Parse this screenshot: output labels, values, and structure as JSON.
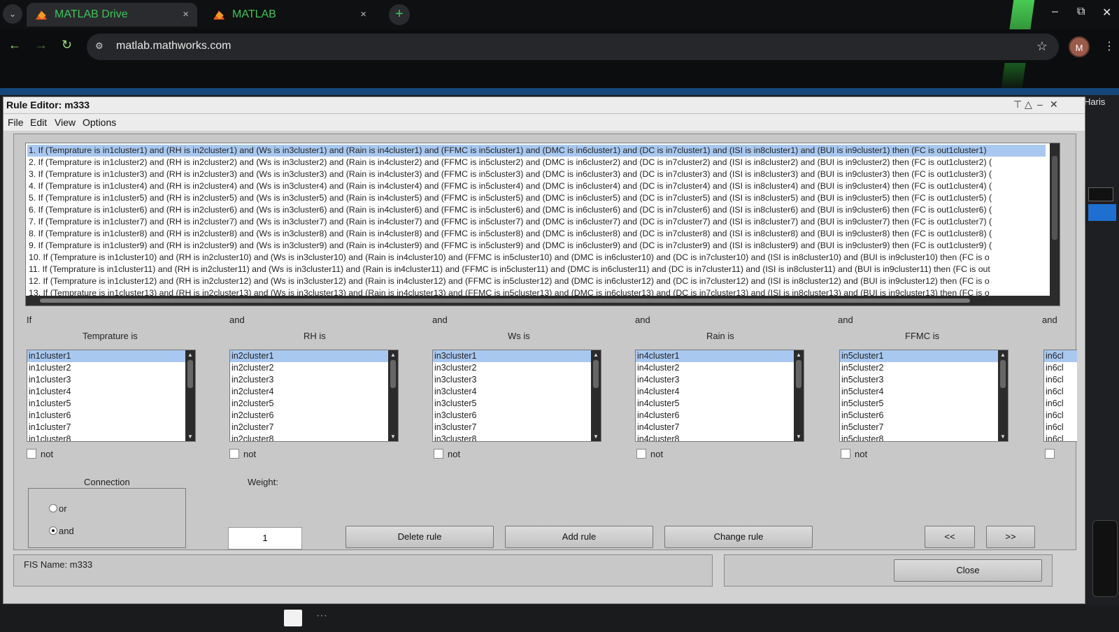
{
  "browser": {
    "tabs": [
      {
        "title": "MATLAB Drive",
        "active": true
      },
      {
        "title": "MATLAB",
        "active": false
      }
    ],
    "close_glyph": "×",
    "new_tab_glyph": "+",
    "url": "matlab.mathworks.com",
    "profile_initial": "M",
    "window_controls": {
      "minimize": "–",
      "restore": "⧉",
      "close": "✕"
    }
  },
  "matlab_user": "Haris",
  "rule_editor": {
    "title": "Rule Editor: m333",
    "menu": [
      "File",
      "Edit",
      "View",
      "Options"
    ],
    "rules": [
      "1. If (Temprature is in1cluster1) and (RH is in2cluster1) and (Ws is in3cluster1) and (Rain is in4cluster1) and (FFMC is in5cluster1) and (DMC is in6cluster1) and (DC is in7cluster1) and (ISI is in8cluster1) and (BUI is in9cluster1) then (FC is out1cluster1)",
      "2. If (Temprature is in1cluster2) and (RH is in2cluster2) and (Ws is in3cluster2) and (Rain is in4cluster2) and (FFMC is in5cluster2) and (DMC is in6cluster2) and (DC is in7cluster2) and (ISI is in8cluster2) and (BUI is in9cluster2) then (FC is out1cluster2) (",
      "3. If (Temprature is in1cluster3) and (RH is in2cluster3) and (Ws is in3cluster3) and (Rain is in4cluster3) and (FFMC is in5cluster3) and (DMC is in6cluster3) and (DC is in7cluster3) and (ISI is in8cluster3) and (BUI is in9cluster3) then (FC is out1cluster3) (",
      "4. If (Temprature is in1cluster4) and (RH is in2cluster4) and (Ws is in3cluster4) and (Rain is in4cluster4) and (FFMC is in5cluster4) and (DMC is in6cluster4) and (DC is in7cluster4) and (ISI is in8cluster4) and (BUI is in9cluster4) then (FC is out1cluster4) (",
      "5. If (Temprature is in1cluster5) and (RH is in2cluster5) and (Ws is in3cluster5) and (Rain is in4cluster5) and (FFMC is in5cluster5) and (DMC is in6cluster5) and (DC is in7cluster5) and (ISI is in8cluster5) and (BUI is in9cluster5) then (FC is out1cluster5) (",
      "6. If (Temprature is in1cluster6) and (RH is in2cluster6) and (Ws is in3cluster6) and (Rain is in4cluster6) and (FFMC is in5cluster6) and (DMC is in6cluster6) and (DC is in7cluster6) and (ISI is in8cluster6) and (BUI is in9cluster6) then (FC is out1cluster6) (",
      "7. If (Temprature is in1cluster7) and (RH is in2cluster7) and (Ws is in3cluster7) and (Rain is in4cluster7) and (FFMC is in5cluster7) and (DMC is in6cluster7) and (DC is in7cluster7) and (ISI is in8cluster7) and (BUI is in9cluster7) then (FC is out1cluster7) (",
      "8. If (Temprature is in1cluster8) and (RH is in2cluster8) and (Ws is in3cluster8) and (Rain is in4cluster8) and (FFMC is in5cluster8) and (DMC is in6cluster8) and (DC is in7cluster8) and (ISI is in8cluster8) and (BUI is in9cluster8) then (FC is out1cluster8) (",
      "9. If (Temprature is in1cluster9) and (RH is in2cluster9) and (Ws is in3cluster9) and (Rain is in4cluster9) and (FFMC is in5cluster9) and (DMC is in6cluster9) and (DC is in7cluster9) and (ISI is in8cluster9) and (BUI is in9cluster9) then (FC is out1cluster9) (",
      "10. If (Temprature is in1cluster10) and (RH is in2cluster10) and (Ws is in3cluster10) and (Rain is in4cluster10) and (FFMC is in5cluster10) and (DMC is in6cluster10) and (DC is in7cluster10) and (ISI is in8cluster10) and (BUI is in9cluster10) then (FC is o",
      "11. If (Temprature is in1cluster11) and (RH is in2cluster11) and (Ws is in3cluster11) and (Rain is in4cluster11) and (FFMC is in5cluster11) and (DMC is in6cluster11) and (DC is in7cluster11) and (ISI is in8cluster11) and (BUI is in9cluster11) then (FC is out",
      "12. If (Temprature is in1cluster12) and (RH is in2cluster12) and (Ws is in3cluster12) and (Rain is in4cluster12) and (FFMC is in5cluster12) and (DMC is in6cluster12) and (DC is in7cluster12) and (ISI is in8cluster12) and (BUI is in9cluster12) then (FC is o",
      "13. If (Temprature is in1cluster13) and (RH is in2cluster13) and (Ws is in3cluster13) and (Rain is in4cluster13) and (FFMC is in5cluster13) and (DMC is in6cluster13) and (DC is in7cluster13) and (ISI is in8cluster13) and (BUI is in9cluster13) then (FC is o"
    ],
    "if_label": "If",
    "and_label": "and",
    "inputs": [
      {
        "label": "Temprature is",
        "items": [
          "in1cluster1",
          "in1cluster2",
          "in1cluster3",
          "in1cluster4",
          "in1cluster5",
          "in1cluster6",
          "in1cluster7",
          "in1cluster8"
        ]
      },
      {
        "label": "RH is",
        "items": [
          "in2cluster1",
          "in2cluster2",
          "in2cluster3",
          "in2cluster4",
          "in2cluster5",
          "in2cluster6",
          "in2cluster7",
          "in2cluster8"
        ]
      },
      {
        "label": "Ws is",
        "items": [
          "in3cluster1",
          "in3cluster2",
          "in3cluster3",
          "in3cluster4",
          "in3cluster5",
          "in3cluster6",
          "in3cluster7",
          "in3cluster8"
        ]
      },
      {
        "label": "Rain is",
        "items": [
          "in4cluster1",
          "in4cluster2",
          "in4cluster3",
          "in4cluster4",
          "in4cluster5",
          "in4cluster6",
          "in4cluster7",
          "in4cluster8"
        ]
      },
      {
        "label": "FFMC is",
        "items": [
          "in5cluster1",
          "in5cluster2",
          "in5cluster3",
          "in5cluster4",
          "in5cluster5",
          "in5cluster6",
          "in5cluster7",
          "in5cluster8"
        ]
      },
      {
        "label": "",
        "items": [
          "in6cl",
          "in6cl",
          "in6cl",
          "in6cl",
          "in6cl",
          "in6cl",
          "in6cl",
          "in6cl"
        ]
      }
    ],
    "not_label": "not",
    "connection": {
      "title": "Connection",
      "options": [
        "or",
        "and"
      ],
      "selected": "and"
    },
    "weight_label": "Weight:",
    "weight_value": "1",
    "buttons": {
      "delete": "Delete rule",
      "add": "Add rule",
      "change": "Change rule",
      "prev": "<<",
      "next": ">>",
      "close": "Close"
    },
    "fis_name": "FIS Name: m333"
  }
}
